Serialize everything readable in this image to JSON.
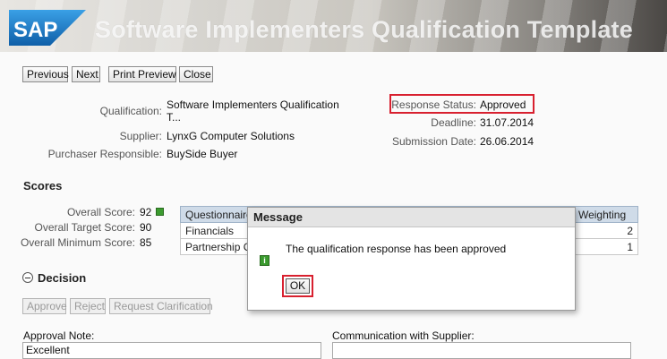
{
  "header": {
    "logo_text": "SAP",
    "title": "Software Implementers Qualification Template",
    "colors": {
      "logo_blue": "#1a7ac4",
      "banner": "#c9c6bf"
    }
  },
  "toolbar": {
    "previous_label": "Previous",
    "next_label": "Next",
    "print_preview_label": "Print Preview",
    "close_label": "Close"
  },
  "details": {
    "qualification_label": "Qualification:",
    "qualification_value_line1": "Software Implementers Qualification",
    "qualification_value_line2": "T...",
    "supplier_label": "Supplier:",
    "supplier_value": "LynxG Computer Solutions",
    "purchaser_label": "Purchaser Responsible:",
    "purchaser_value": "BuySide Buyer",
    "response_status_label": "Response Status:",
    "response_status_value": "Approved",
    "deadline_label": "Deadline:",
    "deadline_value": "31.07.2014",
    "submission_label": "Submission Date:",
    "submission_value": "26.06.2014"
  },
  "scores": {
    "title": "Scores",
    "overall_label": "Overall Score:",
    "overall_value": "92",
    "target_label": "Overall Target Score:",
    "target_value": "90",
    "minimum_label": "Overall Minimum Score:",
    "minimum_value": "85",
    "status_color": "#3c9b2f",
    "table": {
      "col_questionnaire": "Questionnaire",
      "col_weighting": "Weighting",
      "rows": [
        {
          "name": "Financials",
          "weighting": "2"
        },
        {
          "name": "Partnership C",
          "weighting": "1"
        }
      ]
    }
  },
  "decision": {
    "title": "Decision",
    "approve_label": "Approve",
    "reject_label": "Reject",
    "clarification_label": "Request Clarification",
    "approval_note_label": "Approval Note:",
    "approval_note_value": "Excellent",
    "communication_label": "Communication with Supplier:"
  },
  "dialog": {
    "title": "Message",
    "message": "The qualification response has been approved",
    "ok_label": "OK",
    "info_icon": "info-icon"
  }
}
